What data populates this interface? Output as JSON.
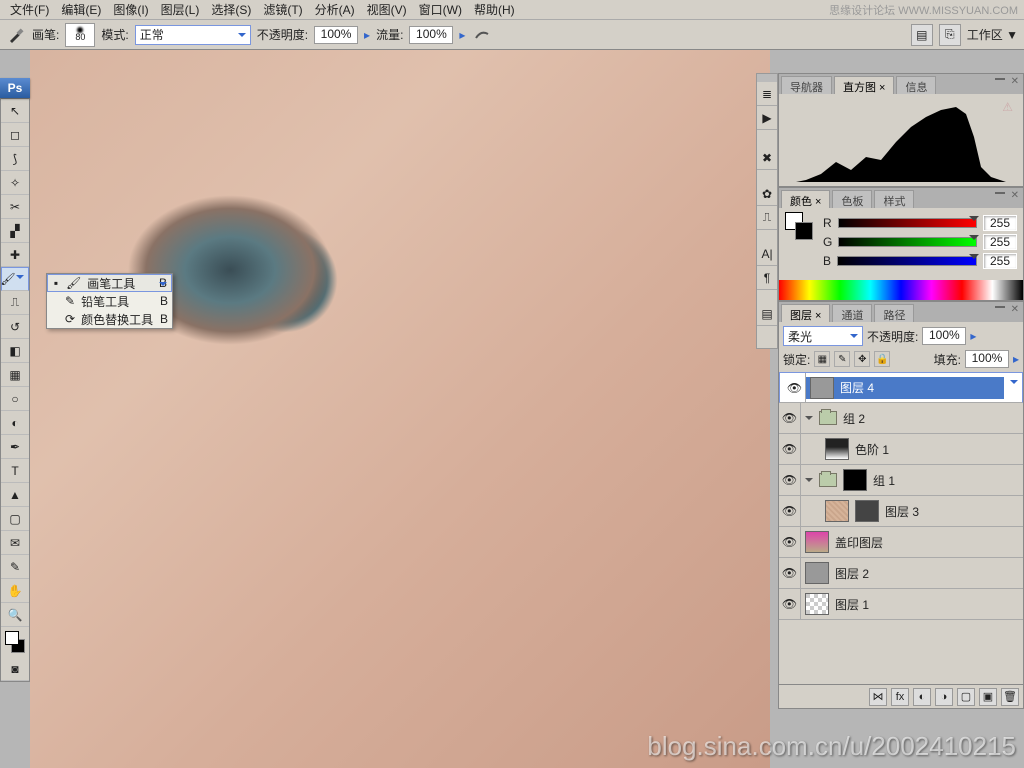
{
  "menu": [
    "文件(F)",
    "编辑(E)",
    "图像(I)",
    "图层(L)",
    "选择(S)",
    "滤镜(T)",
    "分析(A)",
    "视图(V)",
    "窗口(W)",
    "帮助(H)"
  ],
  "watermark_top": "思缘设计论坛  WWW.MISSYUAN.COM",
  "options": {
    "brush_label": "画笔:",
    "brush_size": "80",
    "mode_label": "模式:",
    "mode_value": "正常",
    "opacity_label": "不透明度:",
    "opacity_value": "100%",
    "flow_label": "流量:",
    "flow_value": "100%",
    "workspace": "工作区 ▼"
  },
  "flyout": {
    "items": [
      {
        "icon": "✓",
        "label": "画笔工具",
        "key": "B",
        "sel": true
      },
      {
        "icon": "",
        "label": "铅笔工具",
        "key": "B",
        "sel": false
      },
      {
        "icon": "",
        "label": "颜色替换工具",
        "key": "B",
        "sel": false
      }
    ]
  },
  "nav_tabs": [
    "导航器",
    "直方图 ×",
    "信息"
  ],
  "color_tabs": [
    "颜色 ×",
    "色板",
    "样式"
  ],
  "color": {
    "r_label": "R",
    "g_label": "G",
    "b_label": "B",
    "r": "255",
    "g": "255",
    "b": "255"
  },
  "layer_tabs": [
    "图层 ×",
    "通道",
    "路径"
  ],
  "layers": {
    "blend": "柔光",
    "opacity_label": "不透明度:",
    "opacity": "100%",
    "lock_label": "锁定:",
    "fill_label": "填充:",
    "fill": "100%",
    "items": [
      {
        "name": "图层 4",
        "type": "layer",
        "sel": true,
        "thumb": "gray"
      },
      {
        "name": "组 2",
        "type": "group"
      },
      {
        "name": "色阶 1",
        "type": "adj",
        "indent": 1,
        "thumb": "hist"
      },
      {
        "name": "组 1",
        "type": "group",
        "mask": true
      },
      {
        "name": "图层 3",
        "type": "layer",
        "indent": 1,
        "thumb": "tex",
        "extra_thumb": "bw"
      },
      {
        "name": "盖印图层",
        "type": "layer",
        "thumb": "portrait"
      },
      {
        "name": "图层 2",
        "type": "layer",
        "thumb": "gray"
      },
      {
        "name": "图层 1",
        "type": "layer",
        "thumb": "chk"
      }
    ]
  },
  "watermark": "blog.sina.com.cn/u/2002410215"
}
